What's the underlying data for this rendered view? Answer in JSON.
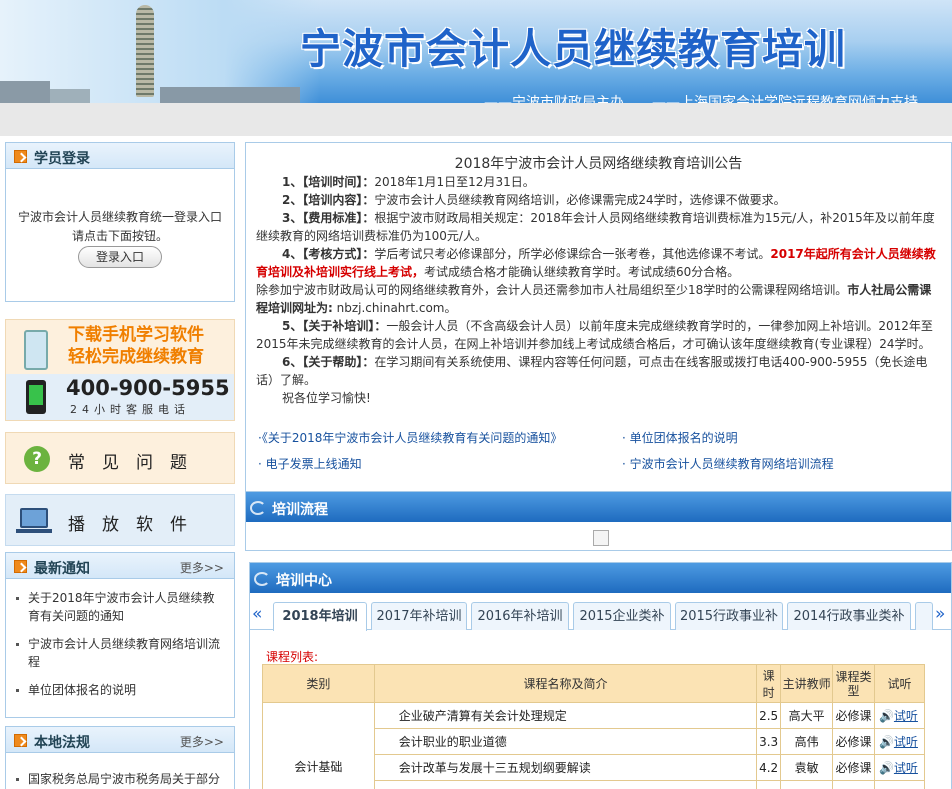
{
  "header": {
    "title": "宁波市会计人员继续教育培训",
    "slogan": "——宁波市财政局主办　　——上海国家会计学院远程教育网倾力支持"
  },
  "login": {
    "title": "学员登录",
    "desc_line1": "宁波市会计人员继续教育统一登录入口",
    "desc_line2": "请点击下面按钮。",
    "button": "登录入口"
  },
  "promo_app": {
    "line1": "下载手机学习软件",
    "line2": "轻松完成继续教育",
    "phone": "400-900-5955",
    "phone_caption": "24小时客服电话"
  },
  "faq": {
    "label": "常　见　问　题"
  },
  "player": {
    "label": "播　放　软　件"
  },
  "news": {
    "title": "最新通知",
    "more": "更多>>",
    "items": [
      "关于2018年宁波市会计人员继续教育有关问题的通知",
      "宁波市会计人员继续教育网络培训流程",
      "单位团体报名的说明"
    ]
  },
  "laws": {
    "title": "本地法规",
    "more": "更多>>",
    "items": [
      "国家税务总局宁波市税务局关于部分"
    ]
  },
  "announcement": {
    "title": "2018年宁波市会计人员网络继续教育培训公告",
    "p1_label": "1、【培训时间】：",
    "p1_text": "2018年1月1日至12月31日。",
    "p2_label": "2、【培训内容】：",
    "p2_text": "宁波市会计人员继续教育网络培训，必修课需完成24学时，选修课不做要求。",
    "p3_label": "3、【费用标准】：",
    "p3_text": "根据宁波市财政局相关规定：2018年会计人员网络继续教育培训费标准为15元/人，补2015年及以前年度继续教育的网络培训费标准仍为100元/人。",
    "p4_label": "4、【考核方式】：",
    "p4_text": "学后考试只考必修课部分，所学必修课综合一张考卷，其他选修课不考试。",
    "p4_red": "2017年起所有会计人员继续教育培训及补培训实行线上考试，",
    "p4_tail": "考试成绩合格才能确认继续教育学时。考试成绩60分合格。",
    "p4b_text": "除参加宁波市财政局认可的网络继续教育外，会计人员还需参加市人社局组织至少18学时的公需课程网络培训。",
    "p4b_bold": "市人社局公需课程培训网址为:",
    "p4b_url": "nbzj.chinahrt.com。",
    "p5_label": "5、【关于补培训】：",
    "p5_text": "一般会计人员（不含高级会计人员）以前年度未完成继续教育学时的，一律参加网上补培训。2012年至2015年未完成继续教育的会计人员，在网上补培训并参加线上考试成绩合格后，才可确认该年度继续教育(专业课程）24学时。",
    "p6_label": "6、【关于帮助】：",
    "p6_text": "在学习期间有关系统使用、课程内容等任何问题，可点击在线客服或拨打电话400-900-5955（免长途电话）了解。",
    "closing": "祝各位学习愉快!"
  },
  "links": [
    "·《关于2018年宁波市会计人员继续教育有关问题的通知》",
    "· 单位团体报名的说明",
    "· 电子发票上线通知",
    "· 宁波市会计人员继续教育网络培训流程"
  ],
  "flow": {
    "title": "培训流程"
  },
  "center": {
    "title": "培训中心",
    "tabs": [
      "2018年培训",
      "2017年补培训",
      "2016年补培训",
      "2015企业类补",
      "2015行政事业补",
      "2014行政事业类补"
    ],
    "list_label": "课程列表:"
  },
  "table": {
    "headers": [
      "类别",
      "课程名称及简介",
      "课时",
      "主讲教师",
      "课程类型",
      "试听"
    ],
    "category": "会计基础",
    "rows": [
      {
        "name": "企业破产清算有关会计处理规定",
        "hours": "2.5",
        "teacher": "高大平",
        "type": "必修课",
        "audition": "试听"
      },
      {
        "name": "会计职业的职业道德",
        "hours": "3.3",
        "teacher": "高伟",
        "type": "必修课",
        "audition": "试听"
      },
      {
        "name": "会计改革与发展十三五规划纲要解读",
        "hours": "4.2",
        "teacher": "袁敏",
        "type": "必修课",
        "audition": "试听"
      }
    ]
  },
  "colors": {
    "accent": "#1f63c9",
    "red": "#d60000",
    "orange": "#ef8a1d"
  }
}
